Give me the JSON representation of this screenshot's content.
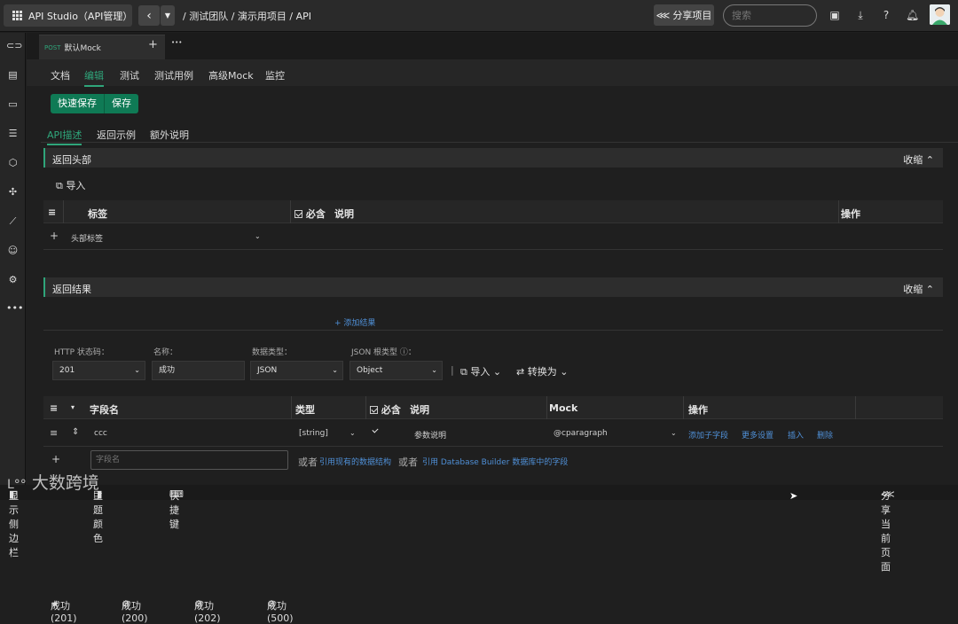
{
  "app": {
    "title": "API Studio（API管理）"
  },
  "breadcrumb": {
    "text": "/ 测试团队 / 演示用项目 / API"
  },
  "header": {
    "share_label": "分享项目",
    "search_placeholder": "搜索"
  },
  "doc_tab": {
    "method": "POST",
    "name": "默认Mock",
    "add": "+",
    "more": "•••"
  },
  "subnav": {
    "items": [
      "文档",
      "编辑",
      "测试",
      "测试用例",
      "高级Mock",
      "监控"
    ],
    "active": "编辑"
  },
  "actions": {
    "quick_save": "快速保存",
    "save": "保存"
  },
  "desc_tabs": [
    "API描述",
    "返回示例",
    "额外说明"
  ],
  "response_headers": {
    "title": "返回头部",
    "collapse": "收缩",
    "import": "导入",
    "columns": {
      "tag": "标签",
      "required": "必含",
      "desc": "说明",
      "ops": "操作"
    },
    "add_row_placeholder": "头部标签"
  },
  "response_results": {
    "title": "返回结果",
    "collapse": "收缩",
    "tabs": [
      "成功 (201)",
      "成功 (200)",
      "成功 (202)",
      "成功 (500)"
    ],
    "add_result": "+ 添加结果",
    "fields": {
      "http_code_label": "HTTP 状态码：",
      "http_code": "201",
      "name_label": "名称：",
      "name": "成功",
      "data_type_label": "数据类型：",
      "data_type": "JSON",
      "root_type_label": "JSON 根类型 ⓘ：",
      "root_type": "Object",
      "import": "导入",
      "convert": "转换为"
    },
    "columns": {
      "field": "字段名",
      "type": "类型",
      "required": "必含",
      "desc": "说明",
      "mock": "Mock",
      "ops": "操作"
    },
    "rows": [
      {
        "field": "ccc",
        "type": "[string]",
        "desc": "参数说明",
        "mock": "@cparagraph",
        "ops": [
          "添加子字段",
          "更多设置",
          "插入",
          "删除"
        ]
      }
    ],
    "new_row": {
      "placeholder": "字段名",
      "or1": "或者",
      "ref_struct": "引用现有的数据结构",
      "or2": "或者",
      "ref_db": "引用 Database Builder 数据库中的字段"
    }
  },
  "footer": {
    "show_sidebar": "显示侧边栏",
    "theme_color": "主题颜色",
    "shortcuts": "快捷键",
    "share_page": "分享当前页面"
  },
  "watermark": "大数跨境"
}
